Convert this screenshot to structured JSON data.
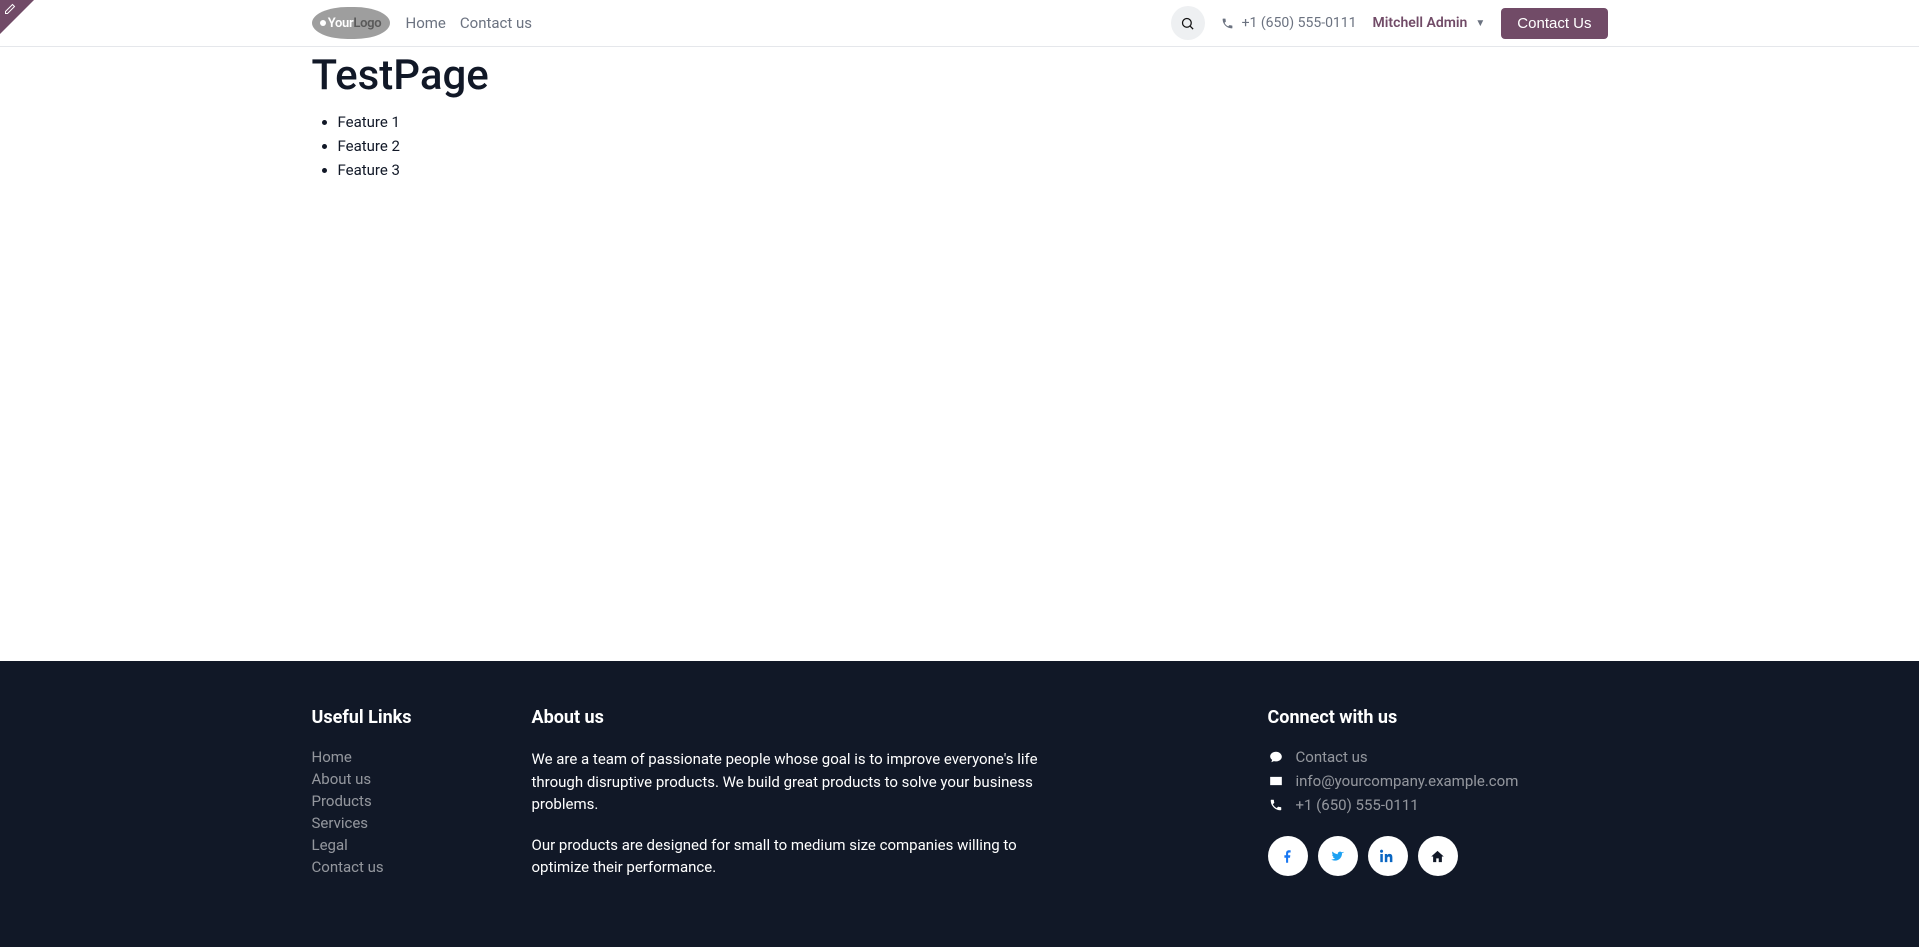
{
  "header": {
    "logo_text_a": "Your",
    "logo_text_b": "Logo",
    "nav": [
      "Home",
      "Contact us"
    ],
    "phone": "+1 (650) 555-0111",
    "user": "Mitchell Admin",
    "contact_btn": "Contact Us"
  },
  "page": {
    "title": "TestPage",
    "features": [
      "Feature 1",
      "Feature 2",
      "Feature 3"
    ]
  },
  "footer": {
    "links_title": "Useful Links",
    "links": [
      "Home",
      "About us",
      "Products",
      "Services",
      "Legal",
      "Contact us"
    ],
    "about_title": "About us",
    "about_p1": "We are a team of passionate people whose goal is to improve everyone's life through disruptive products. We build great products to solve your business problems.",
    "about_p2": "Our products are designed for small to medium size companies willing to optimize their performance.",
    "connect_title": "Connect with us",
    "connect_contact": "Contact us",
    "connect_email": "info@yourcompany.example.com",
    "connect_phone": "+1 (650) 555-0111"
  }
}
